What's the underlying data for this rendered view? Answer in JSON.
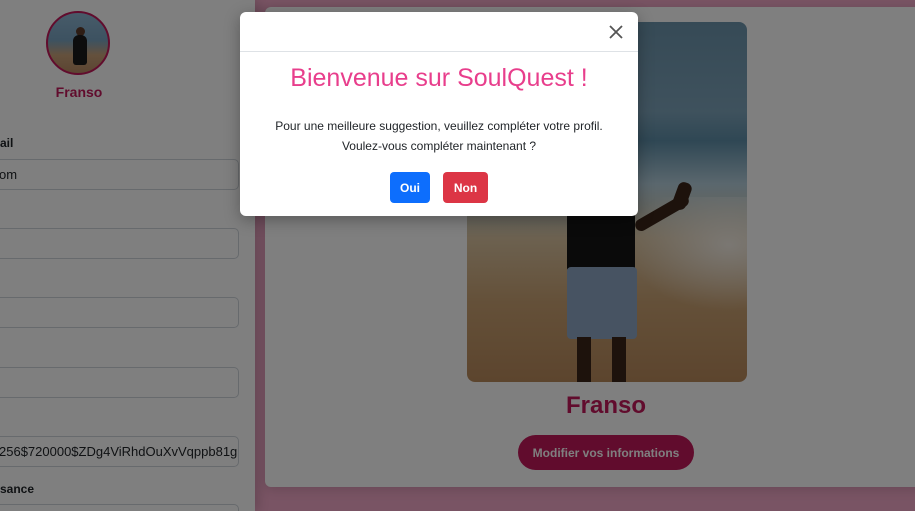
{
  "sidebar": {
    "name": "Franso",
    "fields": [
      {
        "label": "ail",
        "value": "om"
      },
      {
        "label": "",
        "value": ""
      },
      {
        "label": "",
        "value": ""
      },
      {
        "label": "",
        "value": ""
      },
      {
        "label": "",
        "value": "256$720000$ZDg4ViRhdOuXvVqppb81g"
      },
      {
        "label": "sance",
        "value": ""
      }
    ]
  },
  "card": {
    "name": "Franso",
    "edit_button": "Modifier vos informations"
  },
  "modal": {
    "title": "Bienvenue sur SoulQuest !",
    "line1": "Pour une meilleure suggestion, veuillez compléter votre profil.",
    "line2": "Voulez-vous compléter maintenant ?",
    "yes_label": "Oui",
    "no_label": "Non"
  },
  "colors": {
    "brand": "#c2185b",
    "title_pink": "#e83e8c",
    "yes": "#0d6efd",
    "no": "#dc3545"
  }
}
